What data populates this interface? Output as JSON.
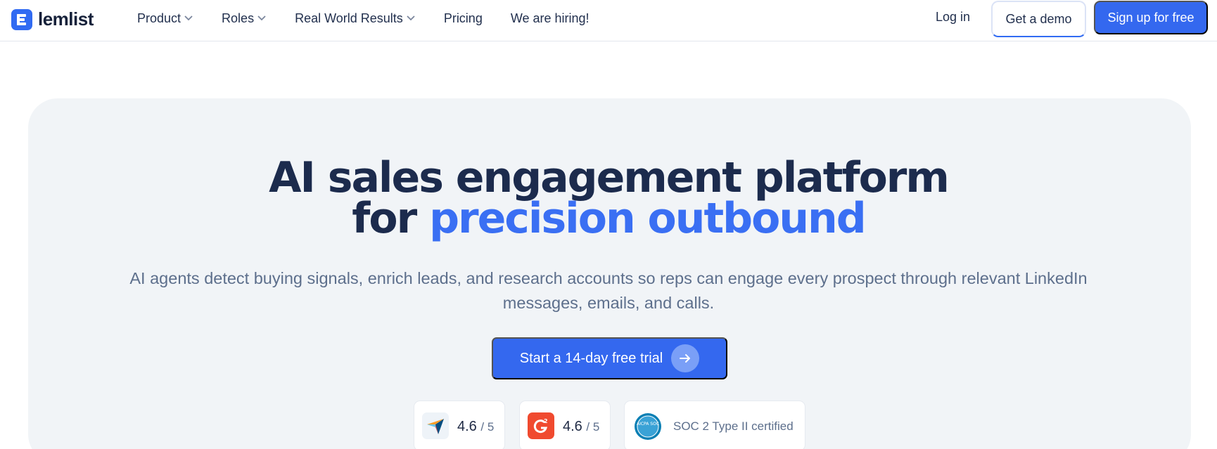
{
  "brand": {
    "name": "lemlist",
    "color": "#316bf2"
  },
  "nav": {
    "links": [
      {
        "label": "Product",
        "has_dropdown": true
      },
      {
        "label": "Roles",
        "has_dropdown": true
      },
      {
        "label": "Real World Results",
        "has_dropdown": true
      },
      {
        "label": "Pricing",
        "has_dropdown": false
      },
      {
        "label": "We are hiring!",
        "has_dropdown": false
      }
    ],
    "login": "Log in",
    "demo": "Get a demo",
    "signup": "Sign up for free"
  },
  "hero": {
    "headline_line1": "AI sales engagement platform",
    "headline_for": "for",
    "headline_accent": "precision outbound",
    "subtitle": "AI agents detect buying signals, enrich leads, and research accounts so reps can engage every prospect through relevant LinkedIn messages, emails, and calls.",
    "cta": "Start a 14-day free trial",
    "accent_color": "#3a6ff3"
  },
  "badges": [
    {
      "icon": "capterra-icon",
      "score": "4.6",
      "denominator": "/ 5"
    },
    {
      "icon": "g2-icon",
      "score": "4.6",
      "denominator": "/ 5"
    },
    {
      "icon": "aicpa-soc-icon",
      "text": "SOC 2 Type II certified",
      "seal_text": "AICPA SOC"
    }
  ]
}
